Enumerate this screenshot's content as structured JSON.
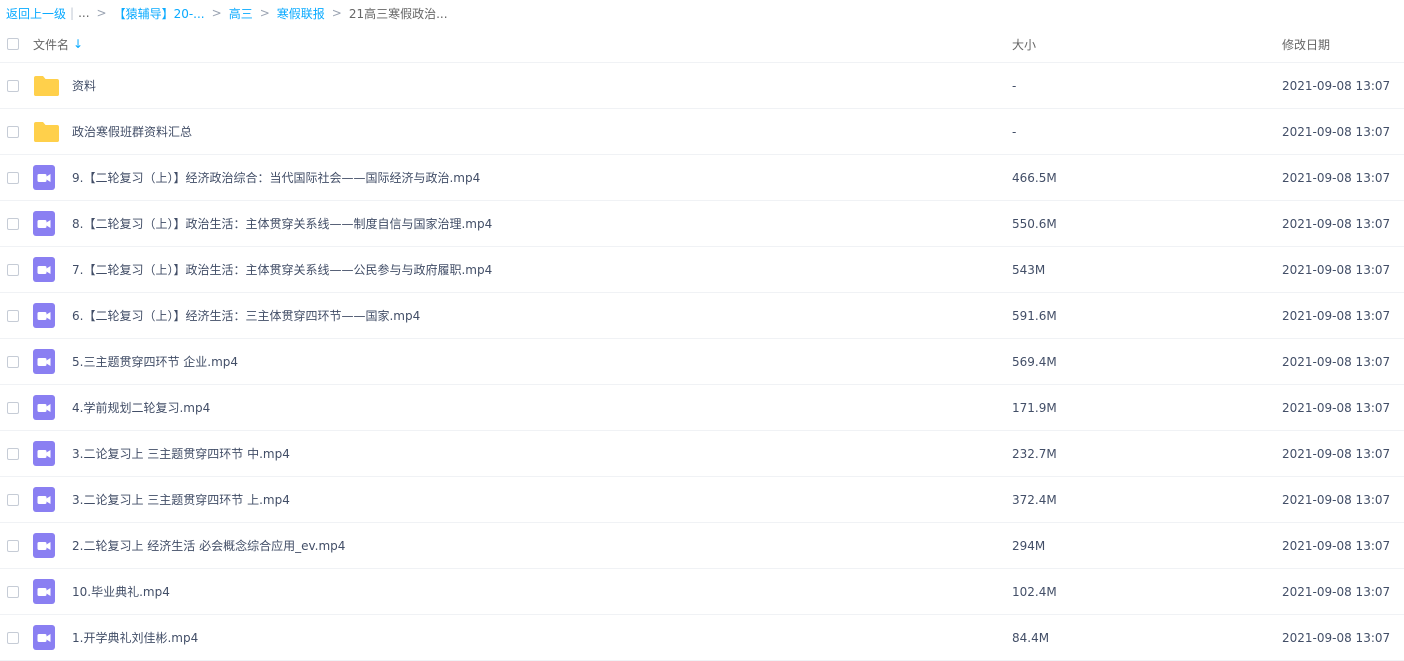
{
  "breadcrumb": {
    "back": "返回上一级",
    "ellipsis": "...",
    "items": [
      "【猿辅导】20-...",
      "高三",
      "寒假联报"
    ],
    "current": "21高三寒假政治..."
  },
  "header": {
    "name": "文件名",
    "sort_icon": "arrow-down-icon",
    "size": "大小",
    "date": "修改日期"
  },
  "colors": {
    "link": "#09aaff",
    "folder": "#ffd04b",
    "video": "#8a7ff2"
  },
  "files": [
    {
      "type": "folder",
      "name": "资料",
      "size": "-",
      "date": "2021-09-08 13:07"
    },
    {
      "type": "folder",
      "name": "政治寒假班群资料汇总",
      "size": "-",
      "date": "2021-09-08 13:07"
    },
    {
      "type": "video",
      "name": "9.【二轮复习（上）】经济政治综合：当代国际社会——国际经济与政治.mp4",
      "size": "466.5M",
      "date": "2021-09-08 13:07"
    },
    {
      "type": "video",
      "name": "8.【二轮复习（上）】政治生活：主体贯穿关系线——制度自信与国家治理.mp4",
      "size": "550.6M",
      "date": "2021-09-08 13:07"
    },
    {
      "type": "video",
      "name": "7.【二轮复习（上）】政治生活：主体贯穿关系线——公民参与与政府履职.mp4",
      "size": "543M",
      "date": "2021-09-08 13:07"
    },
    {
      "type": "video",
      "name": "6.【二轮复习（上）】经济生活：三主体贯穿四环节——国家.mp4",
      "size": "591.6M",
      "date": "2021-09-08 13:07"
    },
    {
      "type": "video",
      "name": "5.三主题贯穿四环节 企业.mp4",
      "size": "569.4M",
      "date": "2021-09-08 13:07"
    },
    {
      "type": "video",
      "name": "4.学前规划二轮复习.mp4",
      "size": "171.9M",
      "date": "2021-09-08 13:07"
    },
    {
      "type": "video",
      "name": "3.二论复习上 三主题贯穿四环节 中.mp4",
      "size": "232.7M",
      "date": "2021-09-08 13:07"
    },
    {
      "type": "video",
      "name": "3.二论复习上 三主题贯穿四环节 上.mp4",
      "size": "372.4M",
      "date": "2021-09-08 13:07"
    },
    {
      "type": "video",
      "name": "2.二轮复习上 经济生活 必会概念综合应用_ev.mp4",
      "size": "294M",
      "date": "2021-09-08 13:07"
    },
    {
      "type": "video",
      "name": "10.毕业典礼.mp4",
      "size": "102.4M",
      "date": "2021-09-08 13:07"
    },
    {
      "type": "video",
      "name": "1.开学典礼刘佳彬.mp4",
      "size": "84.4M",
      "date": "2021-09-08 13:07"
    }
  ]
}
